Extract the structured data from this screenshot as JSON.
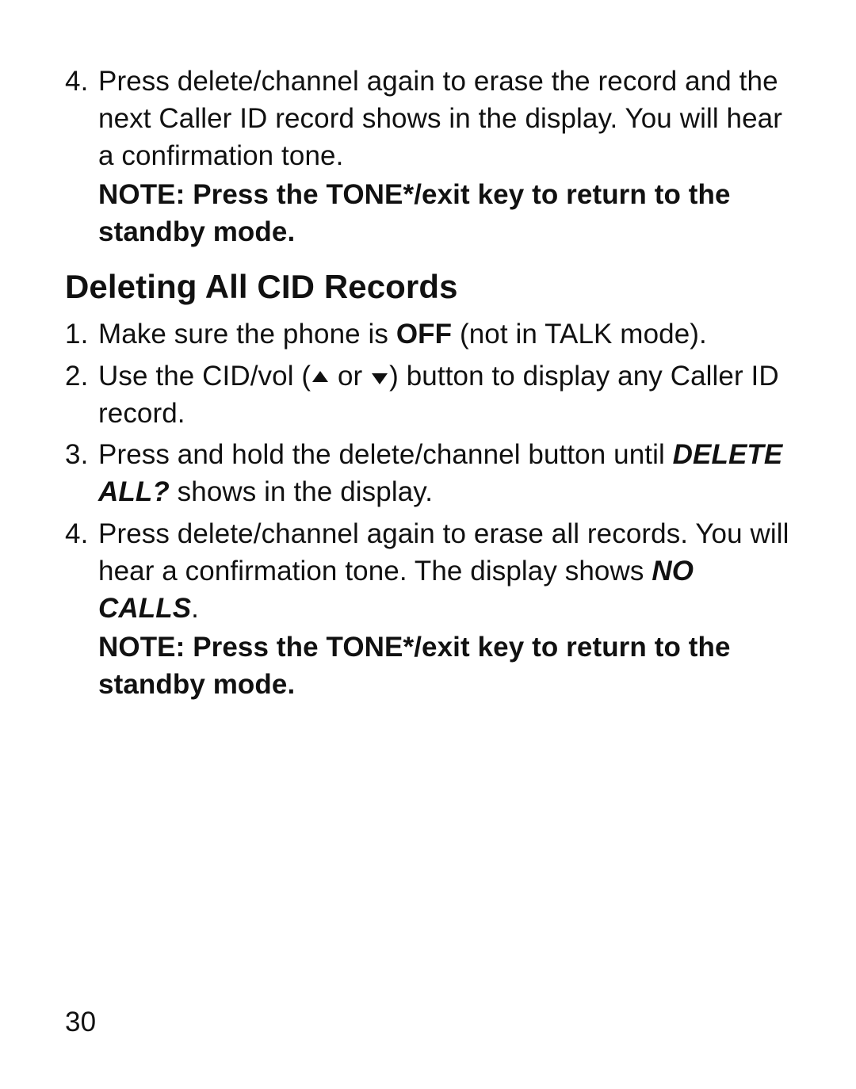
{
  "prev_list": {
    "item4": {
      "num": "4.",
      "text": "Press delete/channel again to erase the record and the next Caller ID record shows in the display. You will hear a confirmation tone.",
      "note": "NOTE: Press the TONE*/exit key to return to the standby mode."
    }
  },
  "heading": "Deleting All CID Records",
  "steps": {
    "s1": {
      "num": "1.",
      "t1": "Make sure the phone is ",
      "off": "OFF",
      "t2": " (not in TALK mode)."
    },
    "s2": {
      "num": "2.",
      "t1": "Use the CID/vol (",
      "or": " or ",
      "t2": ") button to display any Caller ID record."
    },
    "s3": {
      "num": "3.",
      "t1": "Press and hold the delete/channel button until ",
      "delall": "DELETE ALL?",
      "t2": " shows in the display."
    },
    "s4": {
      "num": "4.",
      "t1": "Press delete/channel again to erase all records. You will hear a confirmation tone. The display shows ",
      "nocalls": "NO CALLS",
      "t2": ".",
      "note": "NOTE: Press the TONE*/exit key to return to the standby mode."
    }
  },
  "page_number": "30"
}
